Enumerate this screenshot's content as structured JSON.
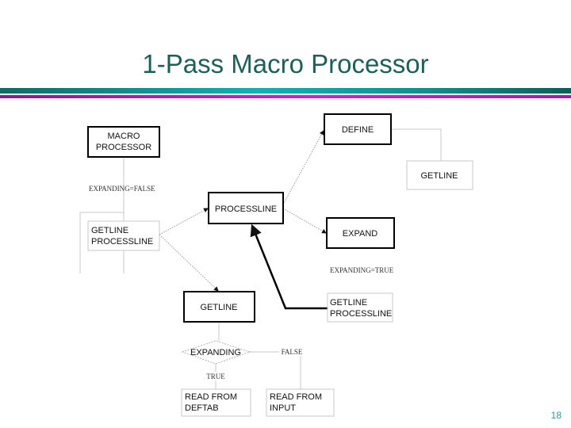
{
  "slide": {
    "title": "1-Pass Macro Processor",
    "page_number": "18",
    "colors": {
      "title": "#1f5f5a",
      "accent_teal": "#11b1b4",
      "accent_magenta": "#d21ed2"
    }
  },
  "diagram": {
    "nodes": {
      "macro_processor": [
        "MACRO",
        "PROCESSOR"
      ],
      "getline_processline_left": [
        "GETLINE",
        "PROCESSLINE"
      ],
      "processline": "PROCESSLINE",
      "define": "DEFINE",
      "getline_define": "GETLINE",
      "expand": "EXPAND",
      "getline_processline_right": [
        "GETLINE",
        "PROCESSLINE"
      ],
      "getline": "GETLINE",
      "expanding_decision": "EXPANDING",
      "read_deftab": [
        "READ FROM",
        "DEFTAB"
      ],
      "read_input": [
        "READ FROM",
        "INPUT"
      ]
    },
    "labels": {
      "expanding_false": "EXPANDING=FALSE",
      "expanding_true": "EXPANDING=TRUE",
      "true_branch": "TRUE",
      "false_branch": "FALSE"
    }
  }
}
